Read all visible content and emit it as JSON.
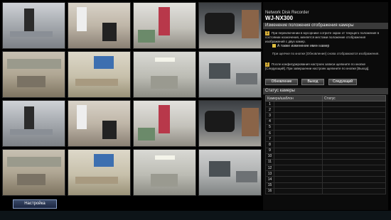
{
  "panel": {
    "brand_line1": "Network Disk Recorder",
    "brand_line2": "WJ-NX300",
    "section_title": "Изменение положения отображения камеры",
    "step1_text": "При переключении в мусорнике сотрите экран от текущего положения в состоянии назначения, меняется местами положение отображения изображений с двух камер.",
    "checkbox_label": "А также изменение имен камер",
    "checkbox_checked": true,
    "step1_note": "При щелчке по кнопке [Обновление] снова отображаются изображения.",
    "step2_text": "После конфигурирования настроек записи щелкните по кнопке [Следующий]. При завершении настроек щелкните по кнопке [Выход].",
    "buttons": {
      "refresh": "Обновление",
      "exit": "Выход",
      "next": "Следующий"
    },
    "status_title": "Статус камеры",
    "table_headers": {
      "name": "Камера/шаблон",
      "status": "Статус"
    },
    "rows": [
      "1",
      "2",
      "3",
      "4",
      "5",
      "6",
      "7",
      "8",
      "9",
      "10",
      "11",
      "12",
      "13",
      "14",
      "15",
      "16"
    ]
  },
  "footer": {
    "setup_button": "Настройка"
  },
  "colors": {
    "accent": "#d8b03a",
    "panel_bg": "#0b0b0b",
    "button_blue": "#1b2540"
  }
}
